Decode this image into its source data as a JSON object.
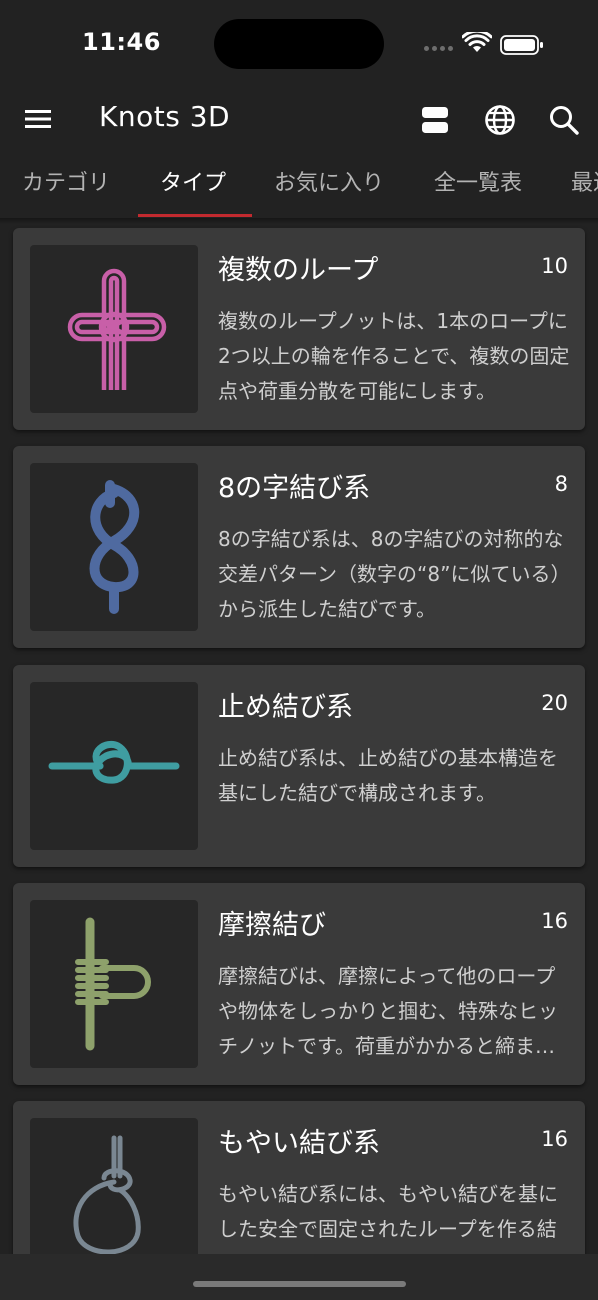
{
  "status_bar": {
    "time": "11:46",
    "icons": [
      "cellular-signal-icon",
      "wifi-icon",
      "battery-icon"
    ]
  },
  "app_bar": {
    "title": "Knots 3D",
    "icons": [
      "menu-icon",
      "view-toggle-icon",
      "globe-icon",
      "search-icon"
    ]
  },
  "tabs": [
    {
      "label": "カテゴリ",
      "active": false
    },
    {
      "label": "タイプ",
      "active": true
    },
    {
      "label": "お気に入り",
      "active": false
    },
    {
      "label": "全一覧表",
      "active": false
    },
    {
      "label": "最近",
      "active": false
    }
  ],
  "cards": [
    {
      "title": "複数のループ",
      "count": "10",
      "description": "複数のループノットは、1本のロープに2つ以上の輪を作ることで、複数の固定点や荷重分散を可能にします。",
      "icon": "multiple-loops-knot-icon",
      "color": "#c85fa8"
    },
    {
      "title": "8の字結び系",
      "count": "8",
      "description": "8の字結び系は、8の字結びの対称的な交差パターン（数字の“8”に似ている）から派生した結びです。",
      "icon": "figure-eight-knot-icon",
      "color": "#4f6aa0"
    },
    {
      "title": "止め結び系",
      "count": "20",
      "description": "止め結び系は、止め結びの基本構造を基にした結びで構成されます。",
      "icon": "overhand-knot-icon",
      "color": "#3f9da1"
    },
    {
      "title": "摩擦結び",
      "count": "16",
      "description": "摩擦結びは、摩擦によって他のロープや物体をしっかりと掴む、特殊なヒッチノットです。荷重がかかると締まります。",
      "icon": "friction-hitch-knot-icon",
      "color": "#8ea16b"
    },
    {
      "title": "もやい結び系",
      "count": "16",
      "description": "もやい結び系には、もやい結びを基にした安全で固定されたループを作る結びが含まれます。",
      "icon": "bowline-knot-icon",
      "color": "#7a8792"
    }
  ]
}
